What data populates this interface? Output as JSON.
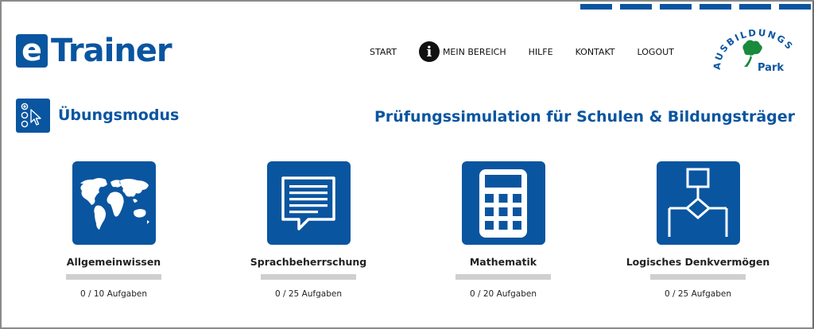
{
  "brand": {
    "logo_letter": "e",
    "logo_name": "Trainer",
    "partner_logo_text": "AUSBILDUNGS",
    "partner_logo_sub": "Park"
  },
  "colors": {
    "primary": "#0a55a0",
    "bar_track": "#cfcfcf"
  },
  "nav": {
    "items": [
      {
        "id": "start",
        "label": "START"
      },
      {
        "id": "mein-bereich",
        "label": "MEIN BEREICH",
        "icon": "info-icon"
      },
      {
        "id": "hilfe",
        "label": "HILFE"
      },
      {
        "id": "kontakt",
        "label": "KONTAKT"
      },
      {
        "id": "logout",
        "label": "LOGOUT"
      }
    ]
  },
  "mode": {
    "title": "Übungsmodus",
    "icon": "radio-cursor-icon"
  },
  "tagline": "Prüfungssimulation für Schulen & Bildungsträger",
  "categories": [
    {
      "label": "Allgemeinwissen",
      "icon": "world-map-icon",
      "done": 0,
      "total": 10,
      "count_text": "0 / 10 Aufgaben"
    },
    {
      "label": "Sprachbeherrschung",
      "icon": "document-speech-icon",
      "done": 0,
      "total": 25,
      "count_text": "0 / 25 Aufgaben"
    },
    {
      "label": "Mathematik",
      "icon": "calculator-icon",
      "done": 0,
      "total": 20,
      "count_text": "0 / 20 Aufgaben"
    },
    {
      "label": "Logisches Denkvermögen",
      "icon": "flowchart-icon",
      "done": 0,
      "total": 25,
      "count_text": "0 / 25 Aufgaben"
    }
  ]
}
